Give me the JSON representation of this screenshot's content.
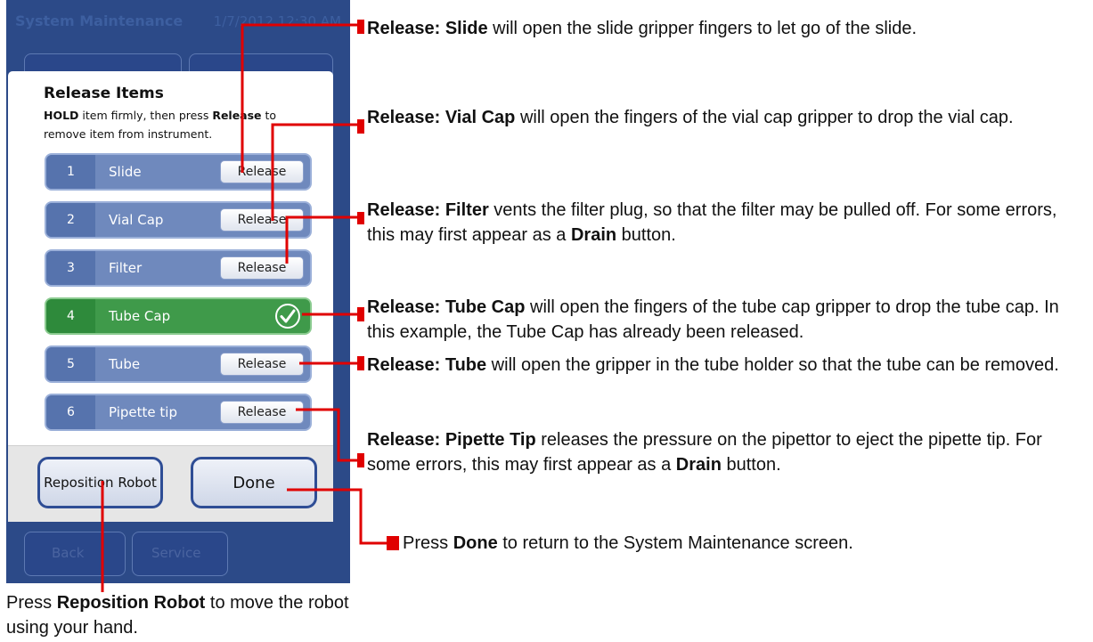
{
  "screen": {
    "title": "System Maintenance",
    "datetime": "1/7/2012 12:30 AM",
    "bg_buttons": {
      "back": "Back",
      "service": "Service"
    },
    "dialog": {
      "title": "Release Items",
      "instruction": {
        "hold": "HOLD",
        "text1": " item firmly, then press ",
        "release_word": "Release",
        "text2": " to remove item from instrument."
      },
      "items": [
        {
          "num": "1",
          "label": "Slide",
          "button": "Release",
          "released": false
        },
        {
          "num": "2",
          "label": "Vial Cap",
          "button": "Release",
          "released": false
        },
        {
          "num": "3",
          "label": "Filter",
          "button": "Release",
          "released": false
        },
        {
          "num": "4",
          "label": "Tube Cap",
          "button": "",
          "released": true
        },
        {
          "num": "5",
          "label": "Tube",
          "button": "Release",
          "released": false
        },
        {
          "num": "6",
          "label": "Pipette tip",
          "button": "Release",
          "released": false
        }
      ],
      "reposition_button": "Reposition Robot",
      "done_button": "Done"
    }
  },
  "annotations": {
    "slide": {
      "bold": "Release: Slide",
      "text": " will open the slide gripper fingers to let go of the slide."
    },
    "vial_cap": {
      "bold": "Release: Vial Cap",
      "text": " will open the fingers of the vial cap gripper to drop the vial cap."
    },
    "filter": {
      "bold": "Release: Filter",
      "text": " vents the filter plug, so that the filter may be pulled off. For some errors, this may first appear as a ",
      "bold2": "Drain",
      "text2": " button."
    },
    "tube_cap": {
      "bold": "Release: Tube Cap",
      "text": " will open the fingers of the tube cap gripper to drop the tube cap. In this example, the Tube Cap has already been released."
    },
    "tube": {
      "bold": "Release: Tube",
      "text": " will open the gripper in the tube holder so that the tube can be removed."
    },
    "pipette_tip": {
      "bold": "Release: Pipette Tip",
      "text": " releases the pressure on the pipettor to eject the pipette tip. For some errors, this may first appear as a ",
      "bold2": "Drain",
      "text2": " button."
    },
    "done": {
      "pre": "Press ",
      "bold": "Done",
      "text": " to return to the System Maintenance screen."
    },
    "reposition": {
      "pre": "Press ",
      "bold": "Reposition Robot",
      "text": " to move the robot using your hand."
    }
  },
  "colors": {
    "leader_line": "#e00000",
    "screen_bg": "#2c4a88",
    "item_row": "#6f89bd",
    "released_row": "#3f9a4a"
  },
  "icons": {
    "released_indicator": "check-circle-icon"
  }
}
